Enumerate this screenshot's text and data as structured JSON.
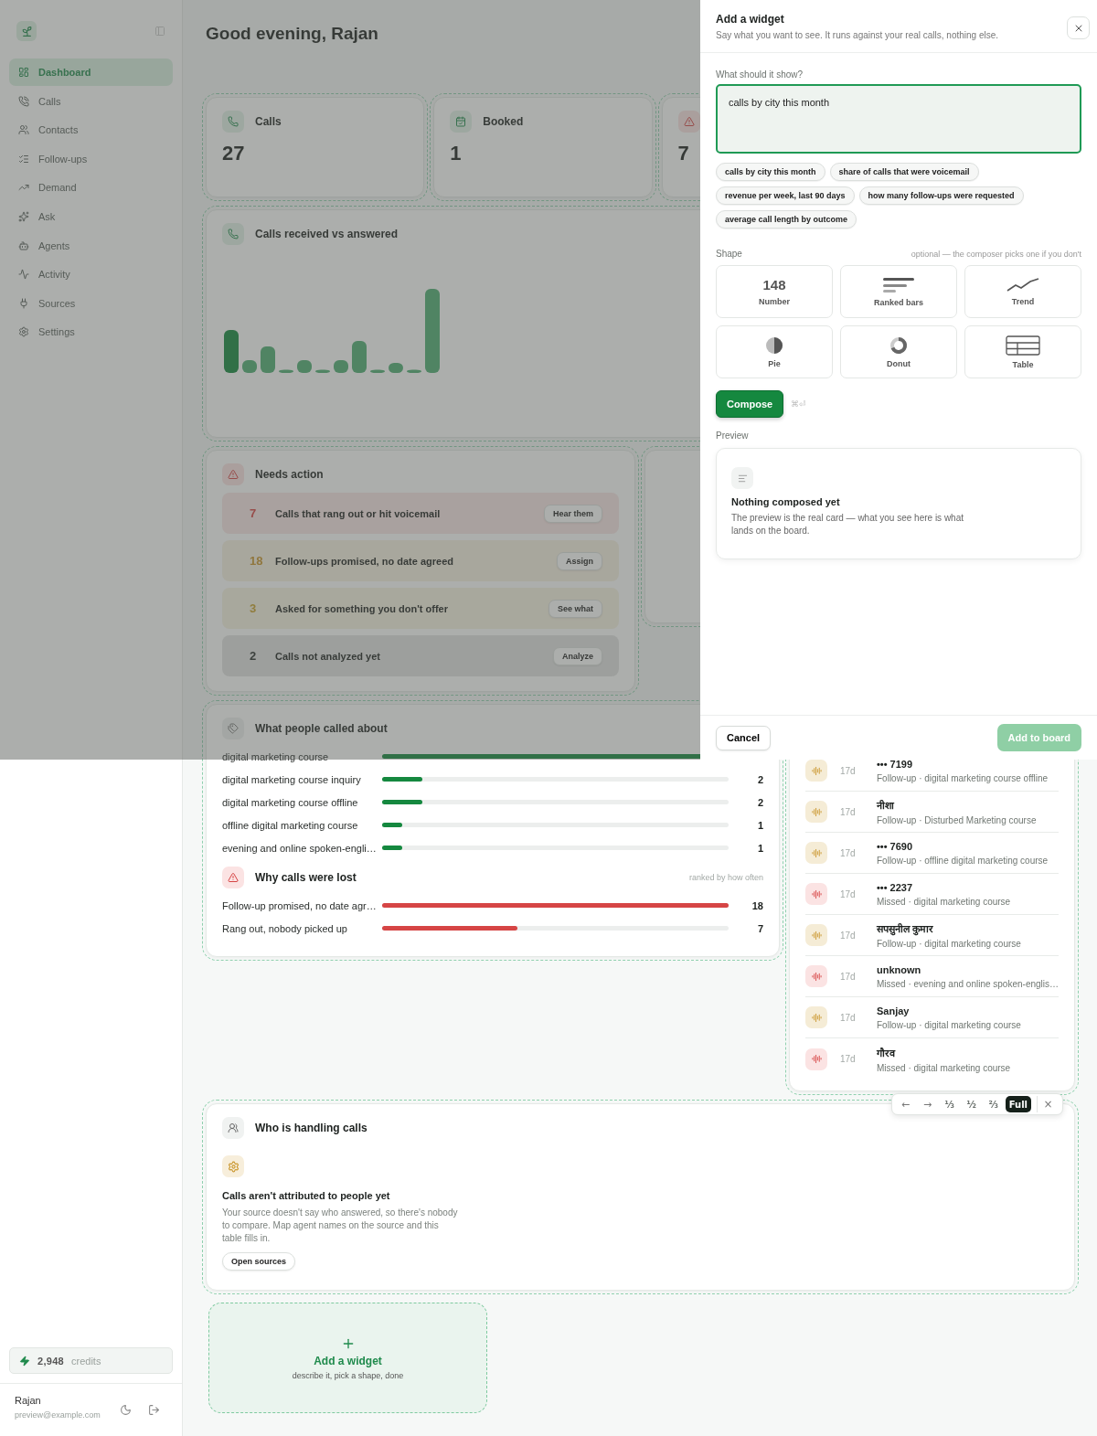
{
  "sidebar": {
    "nav": [
      {
        "label": "Dashboard",
        "selected": true
      },
      {
        "label": "Calls",
        "selected": false
      },
      {
        "label": "Contacts",
        "selected": false
      },
      {
        "label": "Follow-ups",
        "selected": false
      },
      {
        "label": "Demand",
        "selected": false
      },
      {
        "label": "Ask",
        "selected": false
      },
      {
        "label": "Agents",
        "selected": false
      },
      {
        "label": "Activity",
        "selected": false
      },
      {
        "label": "Sources",
        "selected": false
      },
      {
        "label": "Settings",
        "selected": false
      }
    ],
    "credits": {
      "amount": "2,948",
      "label": "credits"
    },
    "user": {
      "name": "Rajan",
      "email": "preview@example.com"
    }
  },
  "header": {
    "title": "Good evening, Rajan"
  },
  "stats": [
    {
      "kind": "calls",
      "label": "Calls",
      "value": "27"
    },
    {
      "kind": "booked",
      "label": "Booked",
      "value": "1"
    },
    {
      "kind": "alert",
      "value": "7"
    }
  ],
  "chart_card": {
    "title": "Calls received vs answered"
  },
  "needs_action": {
    "title": "Needs action",
    "items": [
      {
        "count": "7",
        "title": "Calls that rang out or hit voicemail",
        "action": "Hear them",
        "kind": "missed"
      },
      {
        "count": "18",
        "title": "Follow-ups promised, no date agreed",
        "action": "Assign",
        "kind": "follow-up"
      },
      {
        "count": "3",
        "title": "Asked for something you don't offer",
        "action": "See what",
        "kind": "demand"
      },
      {
        "count": "2",
        "title": "Calls not analyzed yet",
        "action": "Analyze",
        "kind": "pending"
      }
    ]
  },
  "called_about": {
    "title": "What people called about",
    "rows": [
      {
        "label": "digital marketing course",
        "level": 1
      },
      {
        "label": "digital marketing course inquiry",
        "count": "2",
        "level": 0.117
      },
      {
        "label": "digital marketing course offline",
        "count": "2",
        "level": 0.117
      },
      {
        "label": "offline digital marketing course",
        "count": "1",
        "level": 0.058
      },
      {
        "label": "evening and online spoken-engli…",
        "count": "1",
        "level": 0.058
      }
    ]
  },
  "lost": {
    "title": "Why calls were lost",
    "note": "ranked by how often",
    "rows": [
      {
        "label": "Follow-up promised, no date agr…",
        "count": "18",
        "level": 1
      },
      {
        "label": "Rang out, nobody picked up",
        "count": "7",
        "level": 0.39
      }
    ]
  },
  "recent_calls": [
    {
      "kind": "follow-up",
      "time": "17d",
      "name": "••• 7199",
      "detail": "Follow-up · digital marketing course offline"
    },
    {
      "kind": "follow-up",
      "time": "17d",
      "name": "नीशा",
      "detail": "Follow-up · Disturbed Marketing course"
    },
    {
      "kind": "follow-up",
      "time": "17d",
      "name": "••• 7690",
      "detail": "Follow-up · offline digital marketing course"
    },
    {
      "kind": "missed",
      "time": "17d",
      "name": "••• 2237",
      "detail": "Missed · digital marketing course"
    },
    {
      "kind": "follow-up",
      "time": "17d",
      "name": "सपसुनील कुमार",
      "detail": "Follow-up · digital marketing course"
    },
    {
      "kind": "missed",
      "time": "17d",
      "name": "unknown",
      "detail": "Missed · evening and online spoken-englis…"
    },
    {
      "kind": "follow-up",
      "time": "17d",
      "name": "Sanjay",
      "detail": "Follow-up · digital marketing course"
    },
    {
      "kind": "missed",
      "time": "17d",
      "name": "गौरव",
      "detail": "Missed · digital marketing course"
    }
  ],
  "handling": {
    "title": "Who is handling calls",
    "empty_title": "Calls aren't attributed to people yet",
    "empty_text": "Your source doesn't say who answered, so there's nobody to compare. Map agent names on the source and this table fills in.",
    "button": "Open sources",
    "toolbar": [
      {
        "kind": "move",
        "label": "←",
        "selected": false
      },
      {
        "kind": "move",
        "label": "→",
        "selected": false
      },
      {
        "kind": "width",
        "label": "⅓",
        "selected": false
      },
      {
        "kind": "width",
        "label": "½",
        "selected": false
      },
      {
        "kind": "width",
        "label": "⅔",
        "selected": false
      },
      {
        "kind": "width",
        "label": "Full",
        "selected": true
      },
      {
        "kind": "close",
        "label": "×",
        "selected": false
      }
    ]
  },
  "add_tile": {
    "title": "Add a widget",
    "subtitle": "describe it, pick a shape, done"
  },
  "drawer": {
    "title": "Add a widget",
    "subtitle": "Say what you want to see. It runs against your real calls, nothing else.",
    "prompt_label": "What should it show?",
    "prompt_value": "calls by city this month",
    "suggestions": [
      "calls by city this month",
      "share of calls that were voicemail",
      "revenue per week, last 90 days",
      "how many follow-ups were requested",
      "average call length by outcome"
    ],
    "shape_label": "Shape",
    "shape_note": "optional — the composer picks one if you don't",
    "shapes": [
      {
        "kind": "number",
        "label": "Number",
        "sample": "148",
        "selected": false
      },
      {
        "kind": "bars",
        "label": "Ranked bars",
        "selected": false
      },
      {
        "kind": "trend",
        "label": "Trend",
        "selected": false
      },
      {
        "kind": "pie",
        "label": "Pie",
        "selected": false
      },
      {
        "kind": "donut",
        "label": "Donut",
        "selected": false
      },
      {
        "kind": "table",
        "label": "Table",
        "selected": false
      }
    ],
    "compose": "Compose",
    "shortcut": "⌘⏎",
    "preview_label": "Preview",
    "preview": {
      "title": "Nothing composed yet",
      "text": "The preview is the real card — what you see here is what lands on the board."
    },
    "cancel": "Cancel",
    "submit": {
      "label": "Add to board",
      "disabled": true
    }
  }
}
